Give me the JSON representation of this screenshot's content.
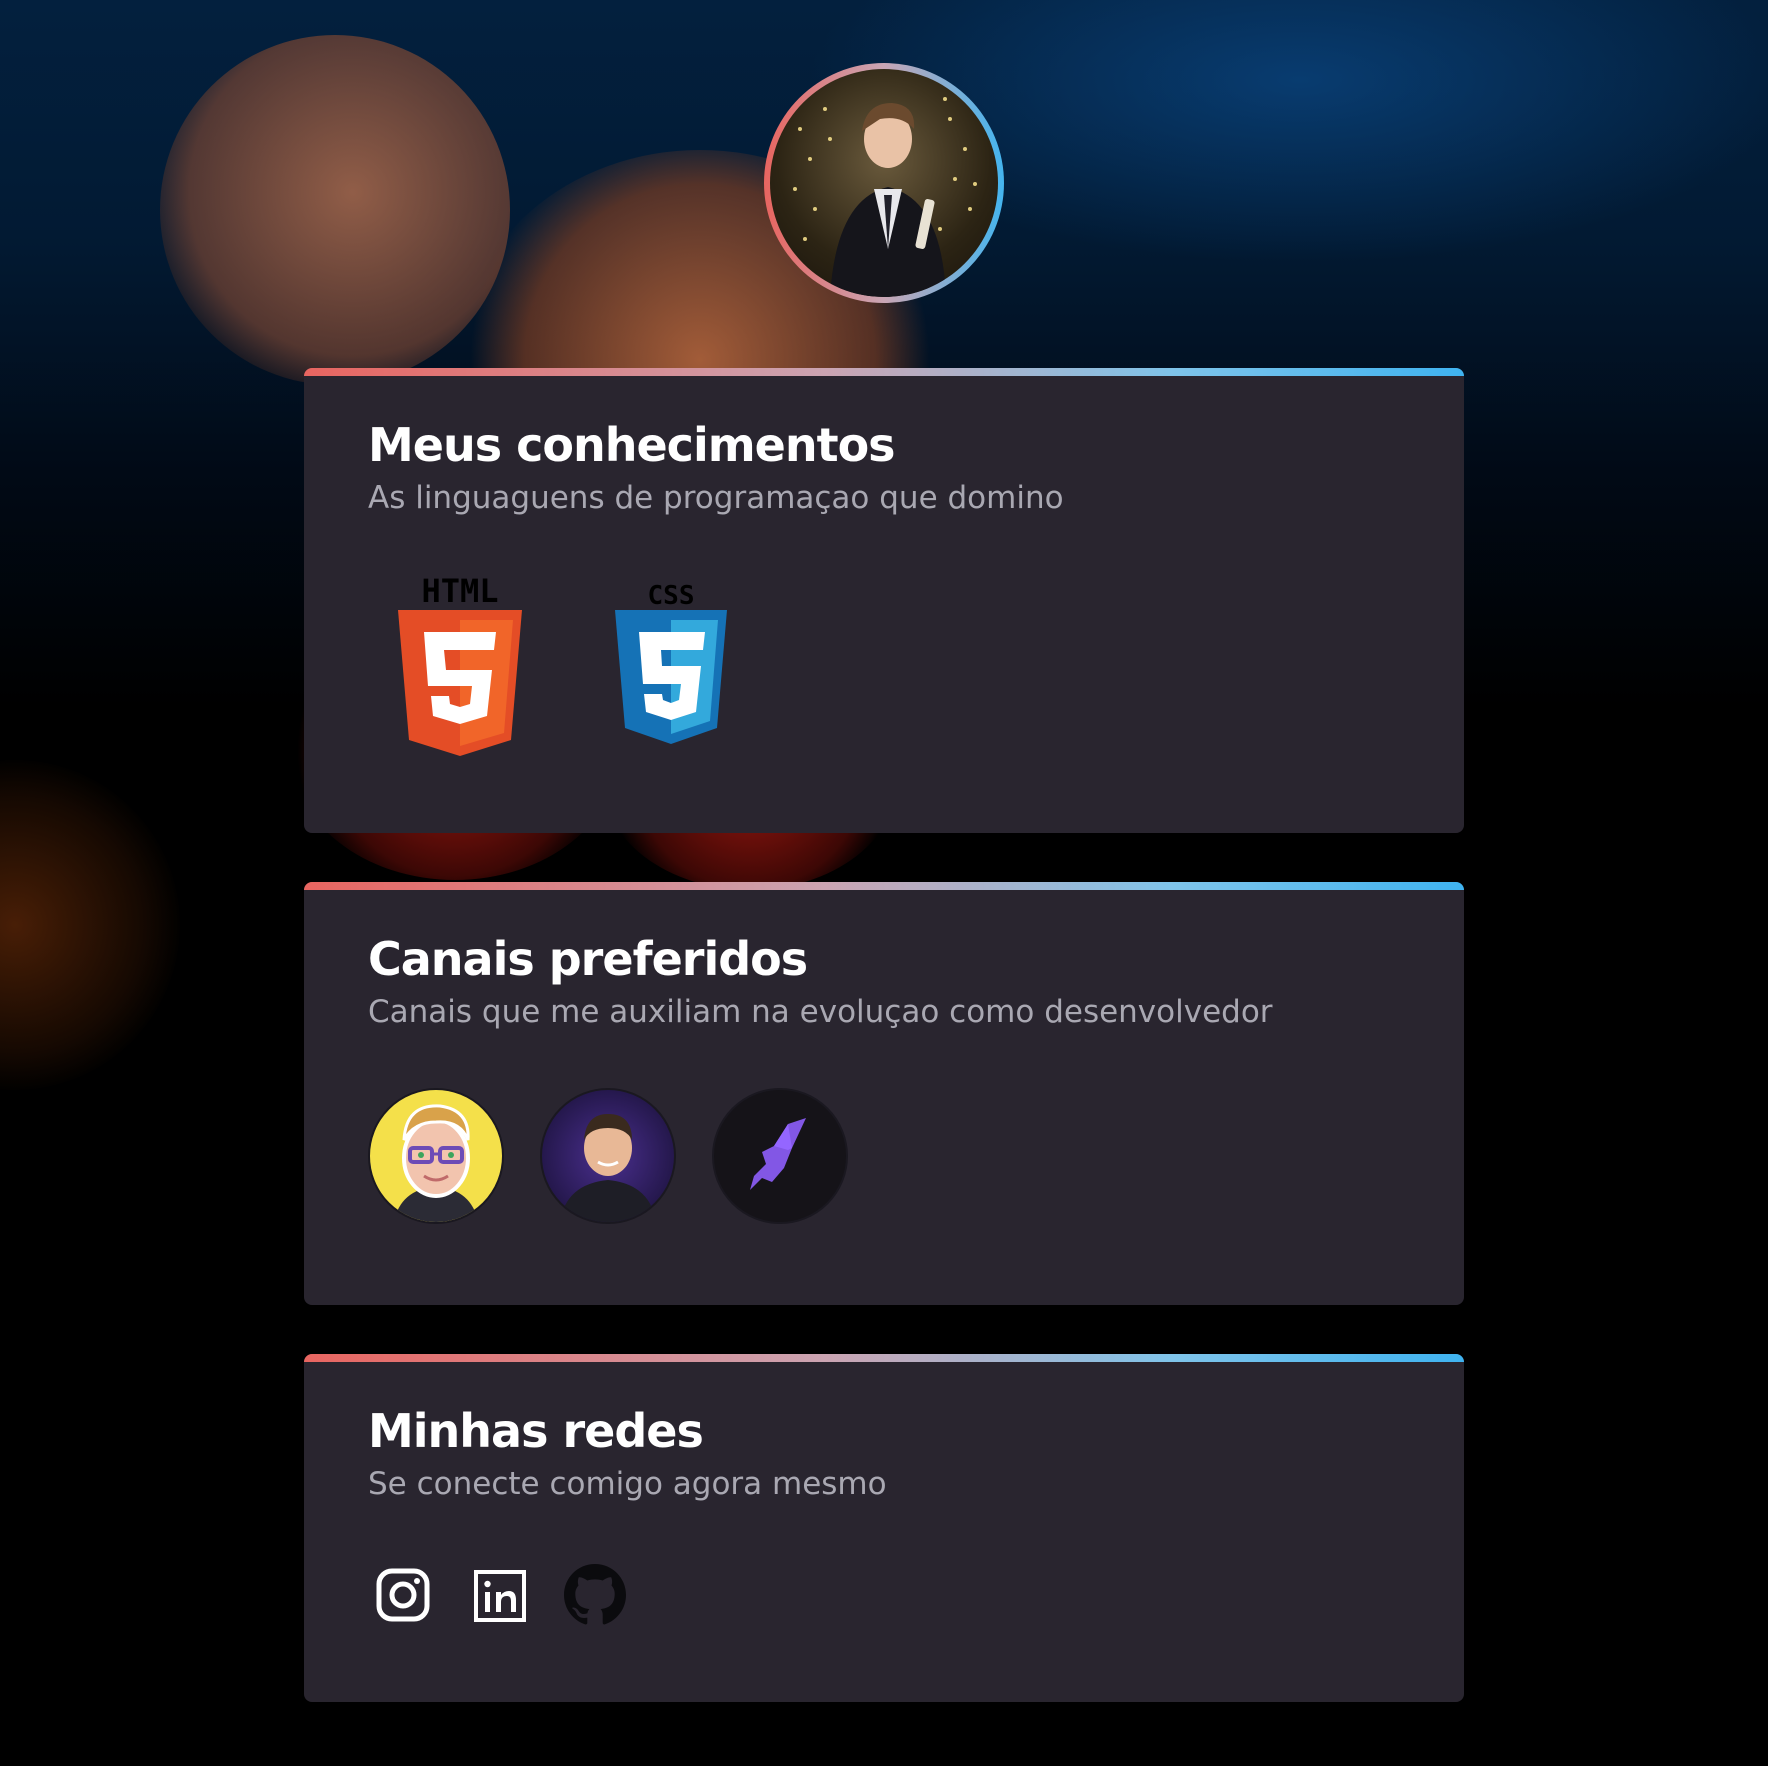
{
  "profile": {
    "photo_icon": "profile-photo"
  },
  "sections": {
    "knowledge": {
      "title": "Meus conhecimentos",
      "subtitle": "As linguaguens de programaçao que domino",
      "items": [
        {
          "icon": "html5-logo",
          "label": "HTML",
          "color": "#e44d26"
        },
        {
          "icon": "css3-logo",
          "label": "CSS",
          "color": "#1572b6"
        }
      ]
    },
    "channels": {
      "title": "Canais preferidos",
      "subtitle": "Canais que me auxiliam na evoluçao como desenvolvedor",
      "items": [
        {
          "icon": "channel-avatar-cartoon"
        },
        {
          "icon": "channel-avatar-person"
        },
        {
          "icon": "channel-avatar-rocketseat"
        }
      ]
    },
    "social": {
      "title": "Minhas redes",
      "subtitle": "Se conecte comigo agora mesmo",
      "items": [
        {
          "icon": "instagram-icon"
        },
        {
          "icon": "linkedin-icon"
        },
        {
          "icon": "github-icon"
        }
      ]
    }
  },
  "colors": {
    "card_bg": "#29252f",
    "gradient_start": "#e86560",
    "gradient_end": "#3fb3f0",
    "subtitle": "#a9a8b2"
  }
}
